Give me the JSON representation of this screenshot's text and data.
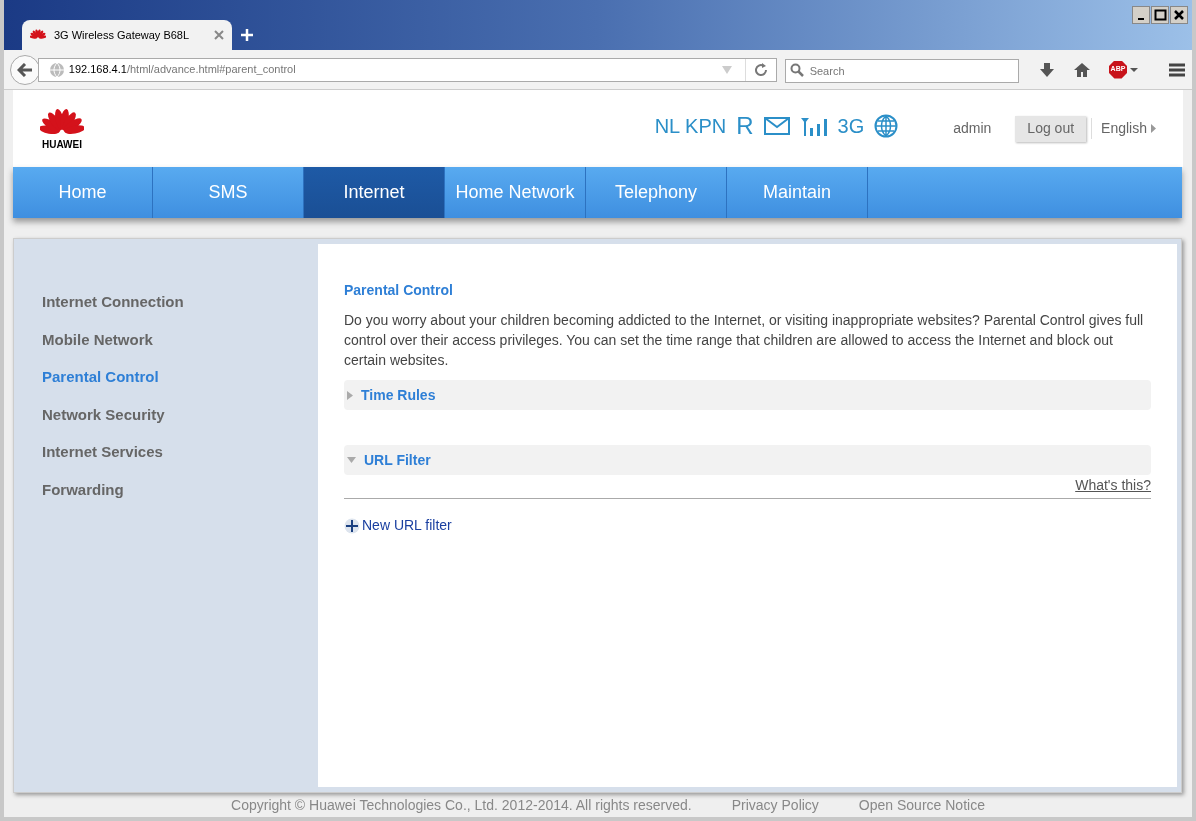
{
  "browser": {
    "tab_title": "3G Wireless Gateway B68L",
    "url_host": "192.168.4.1",
    "url_path": "/html/advance.html#parent_control",
    "search_placeholder": "Search",
    "adblock_label": "ABP"
  },
  "header": {
    "logo_text": "HUAWEI",
    "operator": "NL KPN",
    "roaming": "R",
    "network_type": "3G",
    "user": "admin",
    "logout": "Log out",
    "language": "English"
  },
  "nav": [
    {
      "label": "Home",
      "selected": false
    },
    {
      "label": "SMS",
      "selected": false
    },
    {
      "label": "Internet",
      "selected": true
    },
    {
      "label": "Home Network",
      "selected": false
    },
    {
      "label": "Telephony",
      "selected": false
    },
    {
      "label": "Maintain",
      "selected": false
    }
  ],
  "sidebar": {
    "items": [
      {
        "label": "Internet Connection",
        "selected": false
      },
      {
        "label": "Mobile Network",
        "selected": false
      },
      {
        "label": "Parental Control",
        "selected": true
      },
      {
        "label": "Network Security",
        "selected": false
      },
      {
        "label": "Internet Services",
        "selected": false
      },
      {
        "label": "Forwarding",
        "selected": false
      }
    ]
  },
  "content": {
    "title": "Parental Control",
    "description": "Do you worry about your children becoming addicted to the Internet, or visiting inappropriate websites? Parental Control gives full control over their access privileges. You can set the time range that children are allowed to access the Internet and block out certain websites.",
    "sections": [
      {
        "title": "Time Rules",
        "expanded": false
      },
      {
        "title": "URL Filter",
        "expanded": true,
        "help_link": "What's this?",
        "add_link": "New URL filter"
      }
    ]
  },
  "footer": {
    "copyright": "Copyright © Huawei Technologies Co., Ltd. 2012-2014. All rights reserved.",
    "links": [
      "Privacy Policy",
      "Open Source Notice"
    ]
  }
}
